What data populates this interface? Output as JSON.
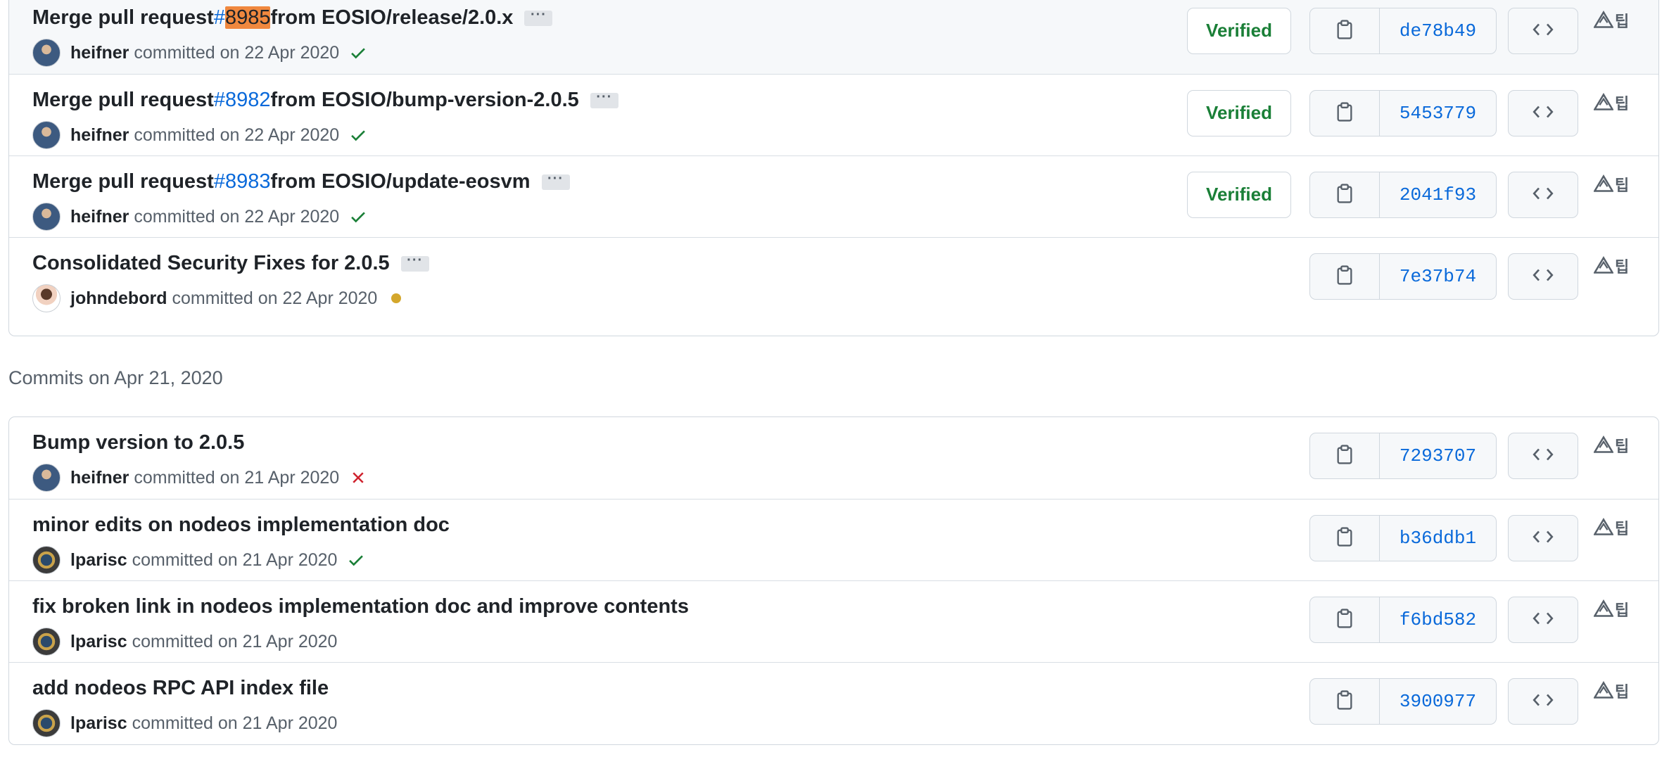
{
  "top_group": {
    "commits": [
      {
        "title_prefix": "Merge pull request ",
        "pr": "#",
        "pr_highlight": "8985",
        "title_suffix": " from EOSIO/release/2.0.x",
        "author": "heifner",
        "committed": "committed on 22 Apr 2020",
        "status": "success",
        "verified": "Verified",
        "sha": "de78b49",
        "avatar": "heifner",
        "highlighted": true
      },
      {
        "title_prefix": "Merge pull request ",
        "pr": "#8982",
        "pr_highlight": "",
        "title_suffix": " from EOSIO/bump-version-2.0.5",
        "author": "heifner",
        "committed": "committed on 22 Apr 2020",
        "status": "success",
        "verified": "Verified",
        "sha": "5453779",
        "avatar": "heifner",
        "highlighted": false
      },
      {
        "title_prefix": "Merge pull request ",
        "pr": "#8983",
        "pr_highlight": "",
        "title_suffix": " from EOSIO/update-eosvm",
        "author": "heifner",
        "committed": "committed on 22 Apr 2020",
        "status": "success",
        "verified": "Verified",
        "sha": "2041f93",
        "avatar": "heifner",
        "highlighted": false
      },
      {
        "title_prefix": "Consolidated Security Fixes for 2.0.5",
        "pr": "",
        "pr_highlight": "",
        "title_suffix": "",
        "author": "johndebord",
        "committed": "committed on 22 Apr 2020",
        "status": "pending",
        "verified": "",
        "sha": "7e37b74",
        "avatar": "johndebord",
        "highlighted": false
      }
    ]
  },
  "date_heading": "Commits on Apr 21, 2020",
  "bottom_group": {
    "commits": [
      {
        "title": "Bump version to 2.0.5",
        "author": "heifner",
        "committed": "committed on 21 Apr 2020",
        "status": "failure",
        "sha": "7293707",
        "avatar": "heifner"
      },
      {
        "title": "minor edits on nodeos implementation doc",
        "author": "lparisc",
        "committed": "committed on 21 Apr 2020",
        "status": "success",
        "sha": "b36ddb1",
        "avatar": "lparisc"
      },
      {
        "title": "fix broken link in nodeos implementation doc and improve contents",
        "author": "lparisc",
        "committed": "committed on 21 Apr 2020",
        "status": "none",
        "sha": "f6bd582",
        "avatar": "lparisc"
      },
      {
        "title": "add nodeos RPC API index file",
        "author": "lparisc",
        "committed": "committed on 21 Apr 2020",
        "status": "none",
        "sha": "3900977",
        "avatar": "lparisc"
      }
    ]
  },
  "ellipsis_label": "···",
  "ext_tip_label": "팁",
  "icons": {
    "copy": "clipboard-icon",
    "browse": "code-icon",
    "ext": "warning-triangle-icon",
    "success": "check-icon",
    "failure": "x-icon",
    "pending": "dot-icon"
  },
  "colors": {
    "link": "#0969da",
    "success": "#1a7f37",
    "failure": "#cf222e",
    "pending": "#d4a72c",
    "highlight": "#f0883e"
  }
}
